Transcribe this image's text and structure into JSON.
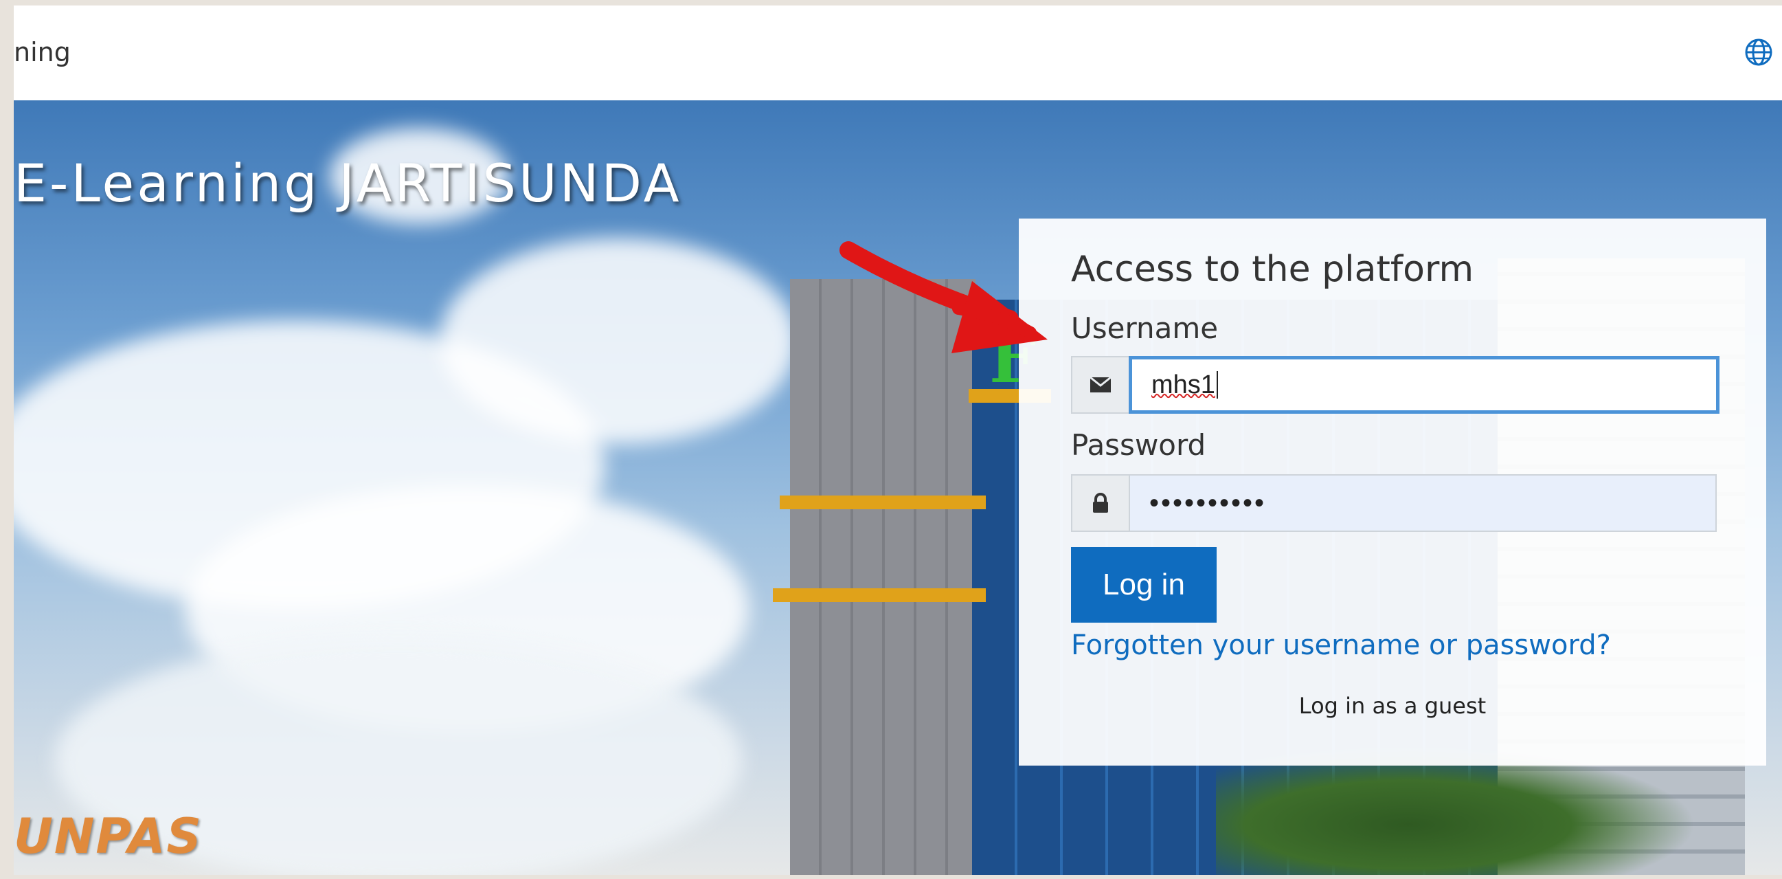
{
  "header": {
    "site_name": "ning",
    "language_icon": "globe-icon"
  },
  "hero": {
    "title": "E-Learning JARTISUNDA",
    "sign_left": "UNPAS",
    "sign_green": "F"
  },
  "login": {
    "heading": "Access to the platform",
    "username_label": "Username",
    "username_icon": "envelope-icon",
    "username_value": "mhs1",
    "password_label": "Password",
    "password_icon": "lock-icon",
    "password_mask": "••••••••••",
    "login_button": "Log in",
    "forgot_link": "Forgotten your username or password?",
    "guest_link": "Log in as a guest"
  },
  "colors": {
    "primary": "#0f6cbf",
    "focus_border": "#4b93d8",
    "annotation_arrow": "#e01616"
  }
}
